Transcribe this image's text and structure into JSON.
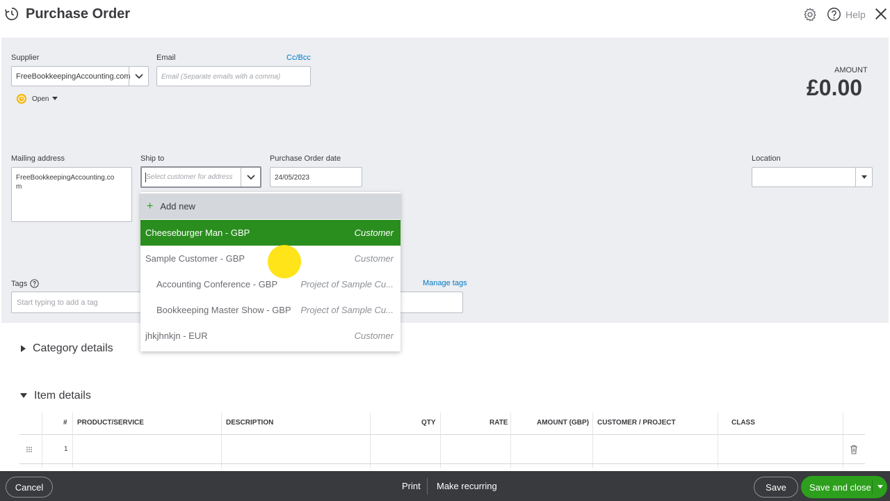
{
  "header": {
    "title": "Purchase Order",
    "help_label": "Help"
  },
  "form": {
    "supplier": {
      "label": "Supplier",
      "value": "FreeBookkeepingAccounting.com"
    },
    "email": {
      "label": "Email",
      "placeholder": "Email (Separate emails with a comma)",
      "ccbcc_label": "Cc/Bcc"
    },
    "status": {
      "value": "Open"
    },
    "amount": {
      "label": "AMOUNT",
      "value": "£0.00"
    },
    "mailing_address": {
      "label": "Mailing address",
      "value": "FreeBookkeepingAccounting.co\nm"
    },
    "ship_to": {
      "label": "Ship to",
      "placeholder": "Select customer for address"
    },
    "po_date": {
      "label": "Purchase Order date",
      "value": "24/05/2023"
    },
    "location": {
      "label": "Location",
      "value": ""
    },
    "tags": {
      "label": "Tags",
      "placeholder": "Start typing to add a tag",
      "manage_label": "Manage tags"
    }
  },
  "ship_to_dropdown": {
    "add_new_label": "Add new",
    "items": [
      {
        "name": "Cheeseburger Man  - GBP",
        "type": "Customer",
        "selected": true,
        "indent": false
      },
      {
        "name": "Sample Customer  - GBP",
        "type": "Customer",
        "selected": false,
        "indent": false
      },
      {
        "name": "Accounting Conference  - GBP",
        "type": "Project of Sample Cu...",
        "selected": false,
        "indent": true
      },
      {
        "name": "Bookkeeping Master Show  - GBP",
        "type": "Project of Sample Cu...",
        "selected": false,
        "indent": true
      },
      {
        "name": "jhkjhnkjn  - EUR",
        "type": "Customer",
        "selected": false,
        "indent": false
      }
    ]
  },
  "sections": {
    "category_details": "Category details",
    "item_details": "Item details"
  },
  "item_table": {
    "columns": [
      "#",
      "PRODUCT/SERVICE",
      "DESCRIPTION",
      "QTY",
      "RATE",
      "AMOUNT (GBP)",
      "CUSTOMER / PROJECT",
      "CLASS"
    ],
    "rows": [
      {
        "num": "1"
      }
    ]
  },
  "footer": {
    "cancel_label": "Cancel",
    "print_label": "Print",
    "recurring_label": "Make recurring",
    "save_label": "Save",
    "save_close_label": "Save and close"
  },
  "colors": {
    "accent_green": "#2ca01c",
    "selected_green": "#2a8e1f",
    "link_blue": "#0077c5",
    "footer_bg": "#393a3d",
    "form_bg": "#eceef1",
    "cursor_highlight": "#ffe100"
  }
}
